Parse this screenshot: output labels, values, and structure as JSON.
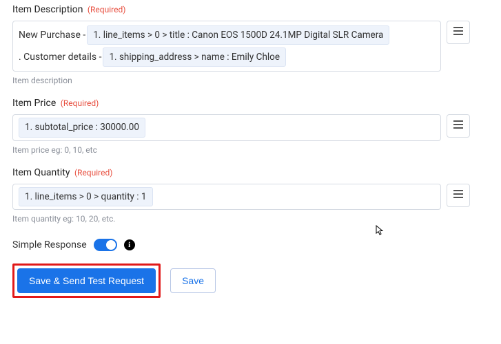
{
  "required_label": "(Required)",
  "item_description": {
    "label": "Item Description",
    "segments": {
      "plain1": "New Purchase -",
      "pill1": "1. line_items > 0 > title : Canon EOS 1500D 24.1MP Digital SLR Camera",
      "plain2": ". Customer details -",
      "pill2": "1. shipping_address > name : Emily Chloe"
    },
    "help": "Item description"
  },
  "item_price": {
    "label": "Item Price",
    "pill": "1. subtotal_price : 30000.00",
    "help": "Item price eg: 0, 10, etc"
  },
  "item_quantity": {
    "label": "Item Quantity",
    "pill": "1. line_items > 0 > quantity : 1",
    "help": "Item quantity eg: 10, 20, etc."
  },
  "simple_response": {
    "label": "Simple Response"
  },
  "buttons": {
    "primary": "Save & Send Test Request",
    "secondary": "Save"
  },
  "info_glyph": "i"
}
